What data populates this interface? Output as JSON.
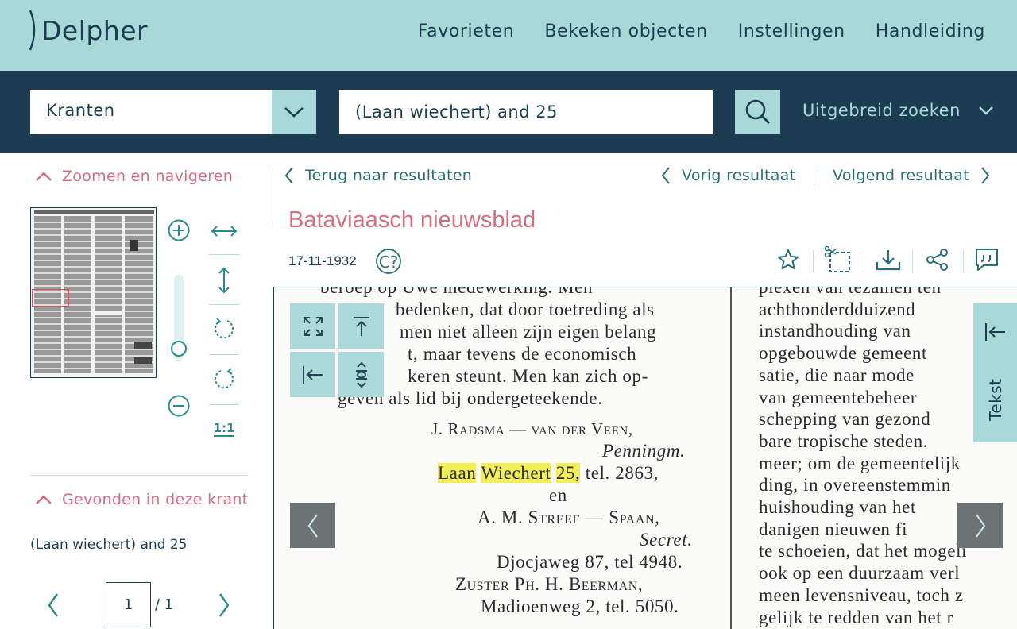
{
  "header": {
    "logo_text": "Delpher",
    "nav": [
      "Favorieten",
      "Bekeken objecten",
      "Instellingen",
      "Handleiding"
    ]
  },
  "search": {
    "collection": "Kranten",
    "query": "(Laan wiechert) and 25",
    "advanced_label": "Uitgebreid zoeken"
  },
  "sidebar": {
    "zoom_section_title": "Zoomen en navigeren",
    "found_section_title": "Gevonden in deze krant",
    "found_query": "(Laan wiechert) and 25",
    "page_current": "1",
    "page_total": "/ 1",
    "zoom_level": 0.1,
    "reset_label": "1:1"
  },
  "results_nav": {
    "back_label": "Terug naar resultaten",
    "prev_label": "Vorig resultaat",
    "next_label": "Volgend resultaat"
  },
  "document": {
    "title": "Bataviaasch nieuwsblad",
    "date": "17-11-1932",
    "copyright_label": "C?",
    "tekst_tab": "Tekst"
  },
  "scan_text": {
    "col1": [
      "beroep op Uwe medewerking. Men",
      "bedenken, dat door toetreding als",
      "men niet alleen zijn eigen belang",
      "t, maar tevens de economisch",
      "keren steunt. Men kan zich op-",
      "geven als lid bij ondergeteekende."
    ],
    "signature1_name": "J. Radsma — van der Veen,",
    "signature1_role": "Penningm.",
    "signature1_hl1": "Laan",
    "signature1_hl2": "Wiechert",
    "signature1_hl3": "25,",
    "signature1_tel": "tel. 2863,",
    "and": "en",
    "signature2_name": "A. M. Streef — Spaan,",
    "signature2_role": "Secret.",
    "signature2_addr": "Djocjaweg 87, tel 4948.",
    "signature3_name": "Zuster Ph. H. Beerman,",
    "signature3_addr": "Madioenweg 2, tel. 5050.",
    "col2": [
      "plexen van tezamen ten",
      "achthonderdduizend",
      "instandhouding van",
      "opgebouwde gemeent",
      "satie, die naar mode",
      "van gemeentebeheer",
      "schepping van gezond",
      "bare tropische steden.",
      "meer; om de gemeentelijk",
      "ding, in overeenstemmin",
      "huishouding van het",
      "danigen nieuwen fi",
      "te schoeien, dat het mogeli",
      "ook op een duurzaam verl",
      "meen levensniveau, toch z",
      "gelijk te redden van het r"
    ]
  },
  "colors": {
    "teal_light": "#a8d8d8",
    "navy": "#1c3d51",
    "pink_accent": "#d86d7e",
    "highlight": "#f2ee5a"
  }
}
